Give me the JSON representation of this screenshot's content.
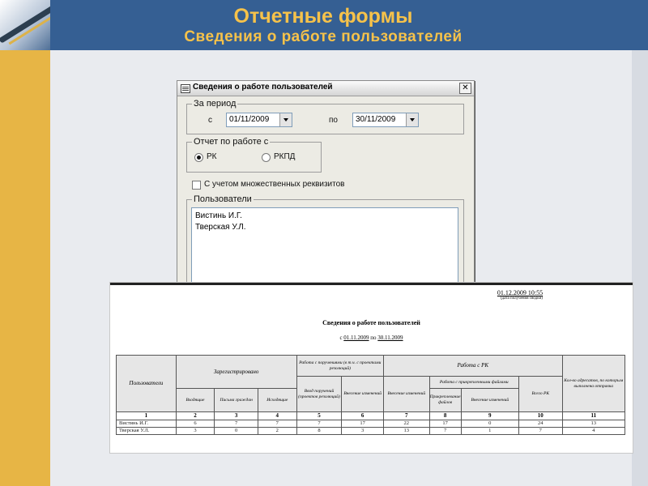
{
  "slide": {
    "title": "Отчетные формы",
    "subtitle": "Сведения о работе пользователей",
    "colors": {
      "accent": "#f6c24a",
      "header": "#355f93",
      "left_bar": "#e7b545"
    }
  },
  "dialog": {
    "title": "Сведения о работе пользователей",
    "close_glyph": "✕",
    "period": {
      "legend": "За период",
      "from_label": "с",
      "from_value": "01/11/2009",
      "to_label": "по",
      "to_value": "30/11/2009"
    },
    "report_type": {
      "legend": "Отчет по работе с",
      "options": [
        {
          "label": "РК",
          "selected": true
        },
        {
          "label": "РКПД",
          "selected": false
        }
      ]
    },
    "multi_requisites_label": "С учетом множественных реквизитов",
    "users": {
      "legend": "Пользователи",
      "items": [
        "Вистинь И.Г.",
        "Тверская У.Л."
      ]
    }
  },
  "report": {
    "date": "01.12.2009 10:55",
    "date_note": "(дата получения сводки)",
    "title": "Сведения о работе пользователей",
    "period_prefix": "с",
    "period_from": "01.11.2009",
    "period_mid": "по",
    "period_to": "30.11.2009",
    "headers": {
      "users": "Пользователи",
      "registered": "Зарегистрировано",
      "incoming": "Входящие",
      "citizen_letters": "Письма граждан",
      "outgoing": "Исходящие",
      "orders_group": "Работа с поручениями (в т.ч. с проектами резолюций)",
      "orders_input": "Ввод поручений (проектов резолюций)",
      "orders_changes": "Внесение изменений",
      "rk_group": "Работа с РК",
      "rk_changes": "Внесение изменений",
      "files_group": "Работа с прикрепленными файлами",
      "files_attach": "Прикреплевание файлов",
      "files_changes": "Внесение изменений",
      "total_rk": "Всего РК",
      "addressees": "Кол-во адресатов, по которым выполнена отправка"
    },
    "column_numbers": [
      "1",
      "2",
      "3",
      "4",
      "5",
      "6",
      "7",
      "8",
      "9",
      "10",
      "11"
    ],
    "rows": [
      [
        "Вистинь И.Г.",
        "6",
        "7",
        "7",
        "7",
        "17",
        "22",
        "17",
        "0",
        "24",
        "13"
      ],
      [
        "Тверская У.Л.",
        "3",
        "0",
        "2",
        "8",
        "3",
        "13",
        "7",
        "1",
        "7",
        "4"
      ]
    ]
  }
}
